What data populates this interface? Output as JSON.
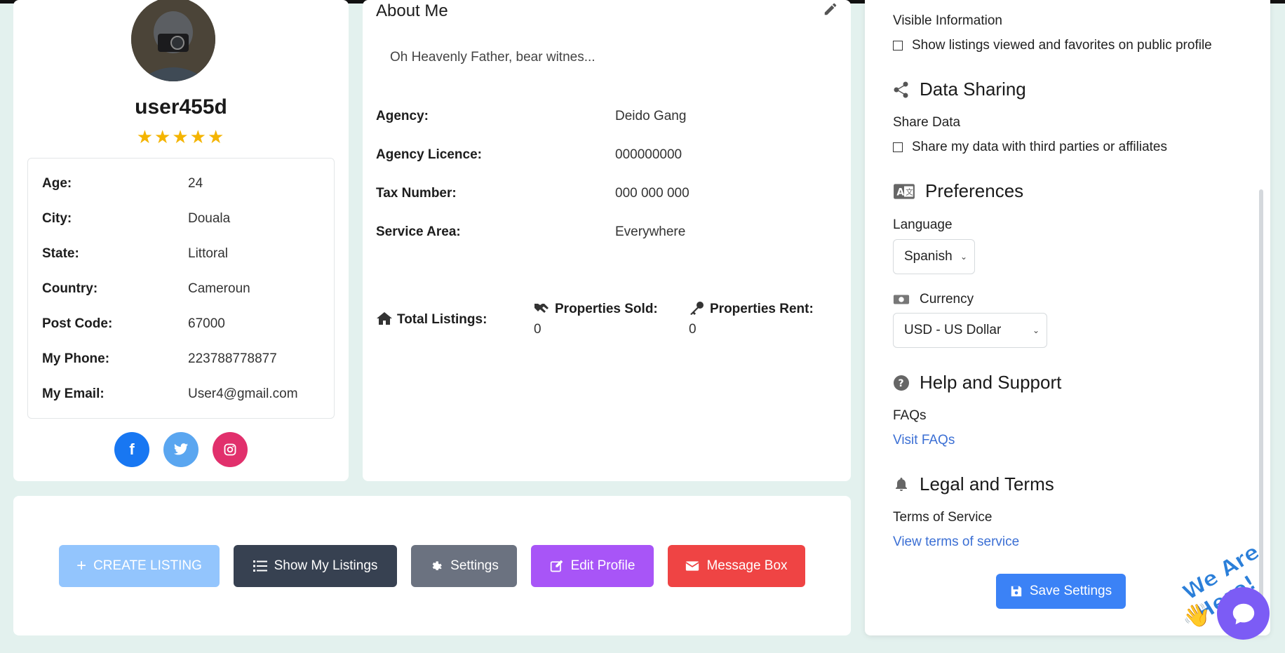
{
  "profile": {
    "username": "user455d",
    "rating": "★★★★★",
    "info": [
      {
        "label": "Age:",
        "value": "24"
      },
      {
        "label": "City:",
        "value": "Douala"
      },
      {
        "label": "State:",
        "value": "Littoral"
      },
      {
        "label": "Country:",
        "value": "Cameroun"
      },
      {
        "label": "Post Code:",
        "value": "67000"
      },
      {
        "label": "My Phone:",
        "value": "223788778877"
      },
      {
        "label": "My Email:",
        "value": "User4@gmail.com"
      }
    ],
    "social": {
      "facebook": "f",
      "twitter": "twitter-icon",
      "instagram": "instagram-icon"
    }
  },
  "about": {
    "title": "About Me",
    "text": "Oh Heavenly Father, bear witnes...",
    "details": [
      {
        "label": "Agency:",
        "value": "Deido Gang"
      },
      {
        "label": "Agency Licence:",
        "value": "000000000"
      },
      {
        "label": "Tax Number:",
        "value": "000 000 000"
      },
      {
        "label": "Service Area:",
        "value": "Everywhere"
      }
    ],
    "stats": {
      "total_label": "Total Listings:",
      "sold_label": "Properties Sold:",
      "sold_value": "0",
      "rent_label": "Properties Rent:",
      "rent_value": "0"
    }
  },
  "actions": {
    "create": "CREATE LISTING",
    "show": "Show My Listings",
    "settings": "Settings",
    "edit": "Edit Profile",
    "message": "Message Box"
  },
  "settings": {
    "visible_info_label": "Visible Information",
    "visible_info_check": "Show listings viewed and favorites on public profile",
    "data_sharing_title": "Data Sharing",
    "share_data_label": "Share Data",
    "share_data_check": "Share my data with third parties or affiliates",
    "preferences_title": "Preferences",
    "language_label": "Language",
    "language_value": "Spanish",
    "currency_label": "Currency",
    "currency_value": "USD - US Dollar",
    "help_title": "Help and Support",
    "faqs_label": "FAQs",
    "faqs_link": "Visit FAQs",
    "legal_title": "Legal and Terms",
    "terms_label": "Terms of Service",
    "terms_link": "View terms of service",
    "save": "Save Settings"
  },
  "chat": {
    "badge": "We Are Here!"
  },
  "colors": {
    "accent": "#3b82f6",
    "background": "#e3f1ee",
    "star": "#f4b400"
  }
}
